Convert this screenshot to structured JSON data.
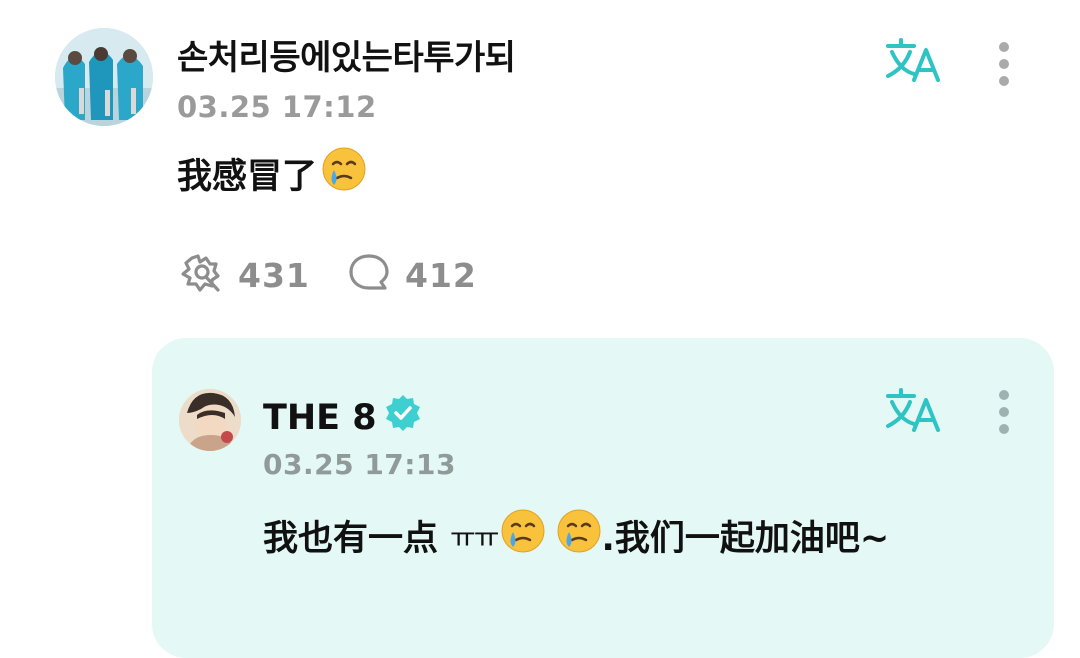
{
  "post": {
    "username": "손처리등에있는타투가되",
    "timestamp": "03.25 17:12",
    "message": "我感冒了",
    "message_emoji": "face-holding-back-tears",
    "stats": {
      "likes": "431",
      "comments": "412"
    }
  },
  "reply": {
    "username": "THE 8",
    "verified": true,
    "timestamp": "03.25 17:13",
    "message_part1": "我也有一点",
    "message_part2": "ㅠㅠ",
    "message_part3": ".我们一起加油吧~",
    "emojis": [
      "face-holding-back-tears",
      "face-holding-back-tears"
    ]
  },
  "colors": {
    "accent": "#2ec4c4",
    "reply_background": "#e4f8f6",
    "timestamp": "#9a9a9a",
    "count": "#8d8d8d"
  }
}
